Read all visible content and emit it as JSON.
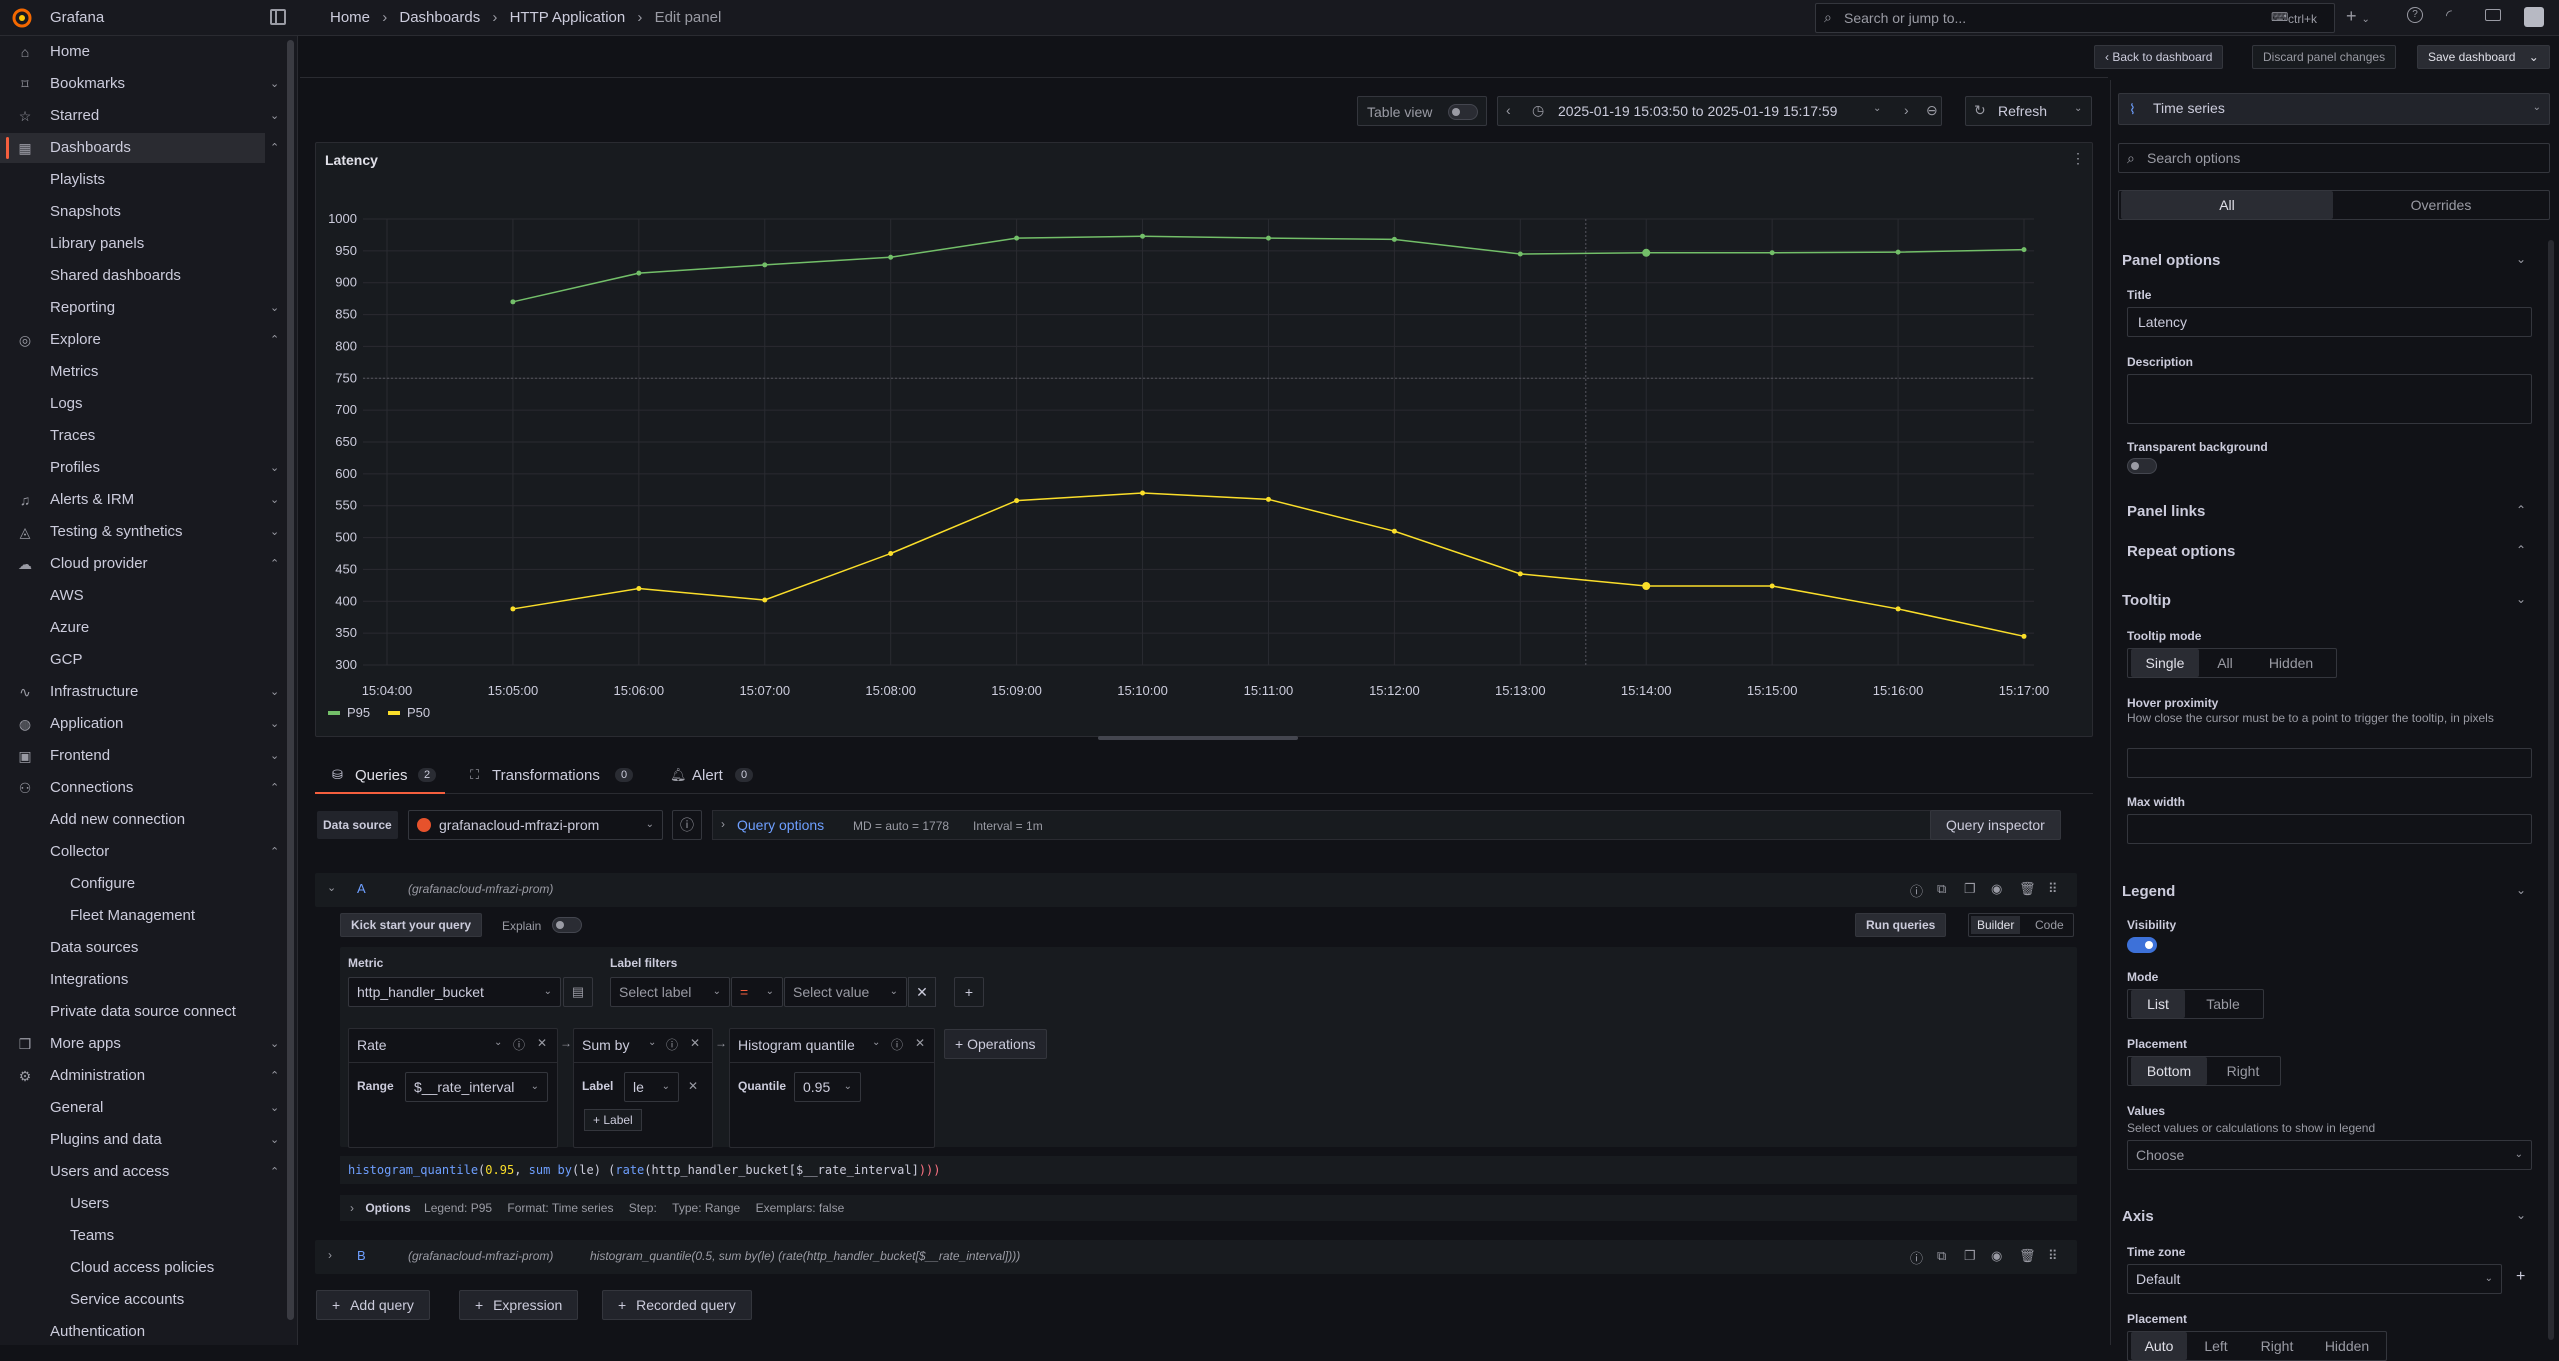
{
  "topbar": {
    "app_name": "Grafana",
    "breadcrumb": [
      "Home",
      "Dashboards",
      "HTTP Application",
      "Edit panel"
    ],
    "search_placeholder": "Search or jump to...",
    "search_shortcut": "ctrl+k",
    "new_label": "+"
  },
  "sidebar": {
    "items": [
      {
        "label": "Home",
        "icon": "home-icon",
        "level": 0,
        "chevron": ""
      },
      {
        "label": "Bookmarks",
        "icon": "bookmark-icon",
        "level": 0,
        "chevron": "down"
      },
      {
        "label": "Starred",
        "icon": "star-icon",
        "level": 0,
        "chevron": "down"
      },
      {
        "label": "Dashboards",
        "icon": "apps-icon",
        "level": 0,
        "chevron": "up",
        "active": true
      },
      {
        "label": "Playlists",
        "level": 1
      },
      {
        "label": "Snapshots",
        "level": 1
      },
      {
        "label": "Library panels",
        "level": 1
      },
      {
        "label": "Shared dashboards",
        "level": 1
      },
      {
        "label": "Reporting",
        "level": 1,
        "chevron": "down"
      },
      {
        "label": "Explore",
        "icon": "compass-icon",
        "level": 0,
        "chevron": "up"
      },
      {
        "label": "Metrics",
        "level": 1
      },
      {
        "label": "Logs",
        "level": 1
      },
      {
        "label": "Traces",
        "level": 1
      },
      {
        "label": "Profiles",
        "level": 1,
        "chevron": "down"
      },
      {
        "label": "Alerts & IRM",
        "icon": "bell-icon",
        "level": 0,
        "chevron": "down"
      },
      {
        "label": "Testing & synthetics",
        "icon": "chart-icon",
        "level": 0,
        "chevron": "down"
      },
      {
        "label": "Cloud provider",
        "icon": "cloud-icon",
        "level": 0,
        "chevron": "up"
      },
      {
        "label": "AWS",
        "level": 1
      },
      {
        "label": "Azure",
        "level": 1
      },
      {
        "label": "GCP",
        "level": 1
      },
      {
        "label": "Infrastructure",
        "icon": "heartbeat-icon",
        "level": 0,
        "chevron": "down"
      },
      {
        "label": "Application",
        "icon": "globe-icon",
        "level": 0,
        "chevron": "down"
      },
      {
        "label": "Frontend",
        "icon": "frontend-icon",
        "level": 0,
        "chevron": "down"
      },
      {
        "label": "Connections",
        "icon": "plug-icon",
        "level": 0,
        "chevron": "up"
      },
      {
        "label": "Add new connection",
        "level": 1
      },
      {
        "label": "Collector",
        "level": 1,
        "chevron": "up"
      },
      {
        "label": "Configure",
        "level": 2
      },
      {
        "label": "Fleet Management",
        "level": 2
      },
      {
        "label": "Data sources",
        "level": 1
      },
      {
        "label": "Integrations",
        "level": 1
      },
      {
        "label": "Private data source connect",
        "level": 1
      },
      {
        "label": "More apps",
        "icon": "cube-icon",
        "level": 0,
        "chevron": "down"
      },
      {
        "label": "Administration",
        "icon": "cog-icon",
        "level": 0,
        "chevron": "up"
      },
      {
        "label": "General",
        "level": 1,
        "chevron": "down"
      },
      {
        "label": "Plugins and data",
        "level": 1,
        "chevron": "down"
      },
      {
        "label": "Users and access",
        "level": 1,
        "chevron": "up"
      },
      {
        "label": "Users",
        "level": 2
      },
      {
        "label": "Teams",
        "level": 2
      },
      {
        "label": "Cloud access policies",
        "level": 2
      },
      {
        "label": "Service accounts",
        "level": 2
      },
      {
        "label": "Authentication",
        "level": 1
      }
    ]
  },
  "toolbar": {
    "back": "Back to dashboard",
    "discard": "Discard panel changes",
    "save": "Save dashboard"
  },
  "panel_controls": {
    "table_view": "Table view",
    "time_range": "2025-01-19 15:03:50 to 2025-01-19 15:17:59",
    "refresh": "Refresh"
  },
  "chart_data": {
    "type": "line",
    "title": "Latency",
    "x": [
      "15:04:00",
      "15:05:00",
      "15:06:00",
      "15:07:00",
      "15:08:00",
      "15:09:00",
      "15:10:00",
      "15:11:00",
      "15:12:00",
      "15:13:00",
      "15:14:00",
      "15:15:00",
      "15:16:00",
      "15:17:00"
    ],
    "series": [
      {
        "name": "P95",
        "color": "#73bf69",
        "values": [
          null,
          870,
          915,
          928,
          940,
          970,
          973,
          970,
          968,
          945,
          947,
          947,
          948,
          952
        ]
      },
      {
        "name": "P50",
        "color": "#fade2a",
        "values": [
          null,
          388,
          420,
          402,
          475,
          558,
          570,
          560,
          510,
          443,
          424,
          424,
          388,
          345
        ]
      }
    ],
    "ylim": [
      300,
      1000
    ],
    "yticks": [
      1000,
      950,
      900,
      850,
      800,
      750,
      700,
      650,
      600,
      550,
      500,
      450,
      400,
      350,
      300
    ],
    "grid": true,
    "legend_position": "bottom-left"
  },
  "query_tabs": {
    "queries": "Queries",
    "queries_count": "2",
    "transformations": "Transformations",
    "transformations_count": "0",
    "alert": "Alert",
    "alert_count": "0"
  },
  "datasource": {
    "label": "Data source",
    "value": "grafanacloud-mfrazi-prom",
    "query_options": "Query options",
    "md": "MD = auto = 1778",
    "interval": "Interval = 1m",
    "inspector": "Query inspector"
  },
  "query_a": {
    "letter": "A",
    "source": "(grafanacloud-mfrazi-prom)",
    "kick_start": "Kick start your query",
    "explain": "Explain",
    "run": "Run queries",
    "builder": "Builder",
    "code": "Code",
    "metric_label": "Metric",
    "metric_value": "http_handler_bucket",
    "label_filters": "Label filters",
    "select_label": "Select label",
    "operator": "=",
    "select_value": "Select value",
    "op_rate": "Rate",
    "range_label": "Range",
    "range_value": "$__rate_interval",
    "op_sum": "Sum by",
    "label_label": "Label",
    "label_value": "le",
    "add_label": "+ Label",
    "op_hist": "Histogram quantile",
    "quantile_label": "Quantile",
    "quantile_value": "0.95",
    "operations": "Operations",
    "expr_fn": "histogram_quantile",
    "expr_num": "0.95",
    "expr_rest1": ", ",
    "expr_sum": "sum by",
    "expr_le": "le",
    "expr_rate": "rate",
    "expr_metric": "http_handler_bucket[$__rate_interval]",
    "options_label": "Options",
    "opt_legend": "Legend: P95",
    "opt_format": "Format: Time series",
    "opt_step": "Step:",
    "opt_type": "Type: Range",
    "opt_exemplars": "Exemplars: false"
  },
  "query_b": {
    "letter": "B",
    "source": "(grafanacloud-mfrazi-prom)",
    "expr": "histogram_quantile(0.5, sum by(le) (rate(http_handler_bucket[$__rate_interval])))"
  },
  "add_buttons": {
    "add_query": "Add query",
    "expression": "Expression",
    "recorded": "Recorded query"
  },
  "options_pane": {
    "viz": "Time series",
    "search_placeholder": "Search options",
    "tab_all": "All",
    "tab_overrides": "Overrides",
    "panel_options": "Panel options",
    "title_label": "Title",
    "title_value": "Latency",
    "description_label": "Description",
    "transparent_label": "Transparent background",
    "panel_links": "Panel links",
    "repeat_options": "Repeat options",
    "tooltip": "Tooltip",
    "tooltip_mode": "Tooltip mode",
    "mode_single": "Single",
    "mode_all": "All",
    "mode_hidden": "Hidden",
    "hover_proximity": "Hover proximity",
    "hover_desc": "How close the cursor must be to a point to trigger the tooltip, in pixels",
    "max_width": "Max width",
    "legend": "Legend",
    "visibility": "Visibility",
    "mode": "Mode",
    "mode_list": "List",
    "mode_table": "Table",
    "placement": "Placement",
    "place_bottom": "Bottom",
    "place_right": "Right",
    "values": "Values",
    "values_desc": "Select values or calculations to show in legend",
    "values_placeholder": "Choose",
    "axis": "Axis",
    "time_zone": "Time zone",
    "tz_value": "Default",
    "axis_placement": "Placement",
    "ap_auto": "Auto",
    "ap_left": "Left",
    "ap_right": "Right",
    "ap_hidden": "Hidden"
  }
}
